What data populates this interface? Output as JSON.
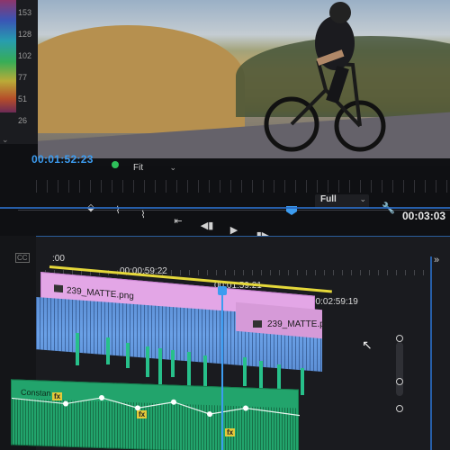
{
  "scopes": {
    "values": [
      "153",
      "128",
      "102",
      "77",
      "51",
      "26"
    ]
  },
  "program_monitor": {
    "timecode": "00:01:52:23",
    "fit_label": "Fit",
    "full_label": "Full",
    "duration_timecode": "00:03:03"
  },
  "timeline": {
    "ruler_labels": [
      ":00",
      "00:00:59:22",
      "00:01:59:21",
      "00:02:59:19"
    ],
    "video_clip_label": "239_MATTE.png",
    "video_clip2_label": "239_MATTE.p",
    "audio_clip_label": "Constan",
    "fx_badge": "fx",
    "cc_badge": "CC"
  },
  "colors": {
    "accent": "#3c9cf0",
    "video_clip": "#e3a6e6",
    "audio_clip": "#22a46c",
    "in_out_bar": "#e5d83a"
  },
  "icons": [
    "marker-icon",
    "mark-in-icon",
    "mark-out-icon",
    "go-to-in-icon",
    "step-back-icon",
    "play-icon",
    "step-forward-icon",
    "go-to-out-icon",
    "lift-icon",
    "extract-icon",
    "export-frame-icon",
    "wrench-icon"
  ]
}
